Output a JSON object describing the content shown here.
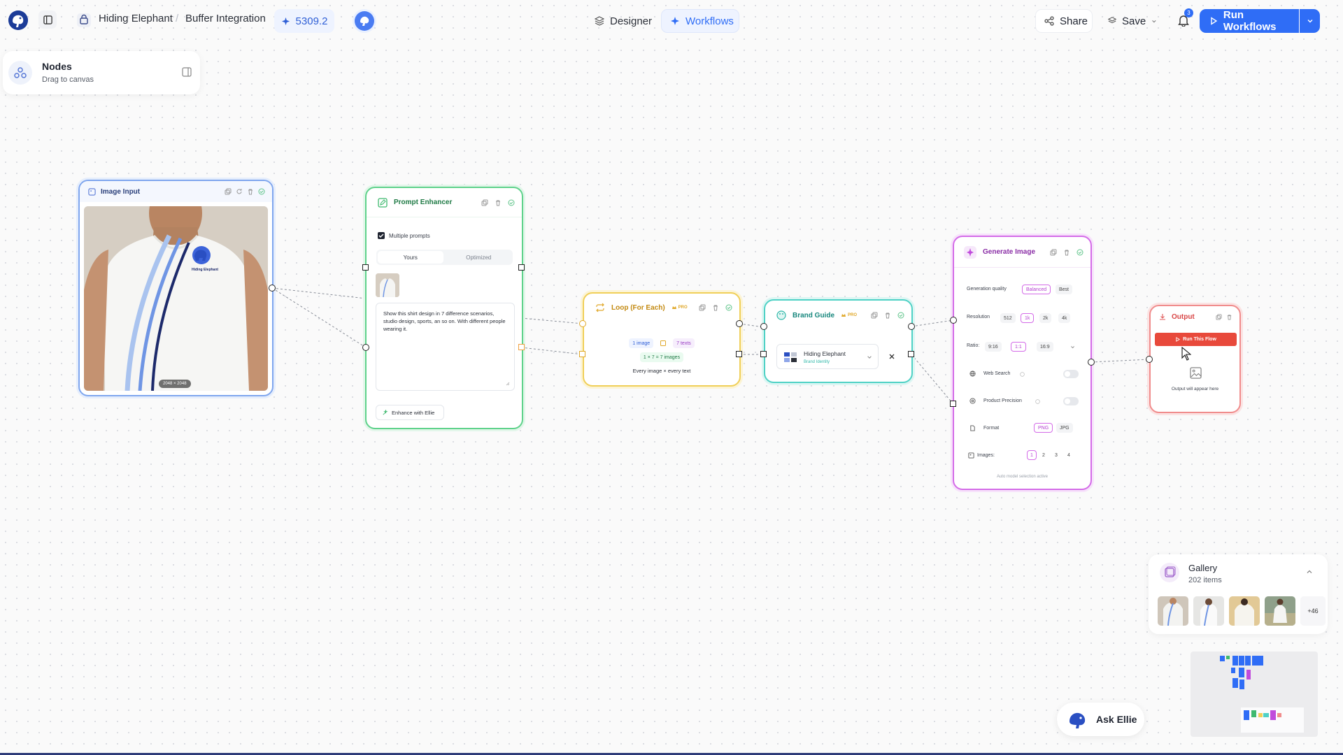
{
  "topbar": {
    "project": "Hiding Elephant",
    "page": "Buffer Integration",
    "credits": "5309.2",
    "tab_designer": "Designer",
    "tab_workflows": "Workflows",
    "share": "Share",
    "save": "Save",
    "notification_count": "3",
    "run": "Run Workflows"
  },
  "nodes_panel": {
    "title": "Nodes",
    "subtitle": "Drag to canvas"
  },
  "image_input": {
    "title": "Image Input",
    "size": "2048 × 2048",
    "shirt_brand": "Hiding Elephant"
  },
  "prompt_enhancer": {
    "title": "Prompt Enhancer",
    "multiple": "Multiple prompts",
    "tab_yours": "Yours",
    "tab_optimized": "Optimized",
    "prompt": "Show this shirt design in 7 difference scenarios, studio design, sports, an so on. With different people wearing it.",
    "enhance": "Enhance with Ellie"
  },
  "loop": {
    "title": "Loop (For Each)",
    "badge": "PRO",
    "images": "1 image",
    "texts": "7 texts",
    "result": "1 × 7 = 7 images",
    "desc": "Every image × every text"
  },
  "brand_guide": {
    "title": "Brand Guide",
    "badge": "PRO",
    "brand": "Hiding Elephant",
    "brand_sub": "Brand Identity"
  },
  "generate": {
    "title": "Generate Image",
    "quality_label": "Generation quality",
    "quality_opts": [
      "Balanced",
      "Best"
    ],
    "resolution_label": "Resolution",
    "res_opts": [
      "512",
      "1k",
      "2k",
      "4k"
    ],
    "ratio_label": "Ratio:",
    "ratio_opts": [
      "9:16",
      "1:1",
      "16:9"
    ],
    "web_search": "Web Search",
    "precision": "Product Precision",
    "format_label": "Format",
    "format_opts": [
      "PNG",
      "JPG"
    ],
    "images_label": "Images:",
    "images_opts": [
      "1",
      "2",
      "3",
      "4"
    ],
    "footer": "Auto model selection active"
  },
  "output": {
    "title": "Output",
    "run": "Run This Flow",
    "placeholder": "Output will appear here"
  },
  "gallery": {
    "title": "Gallery",
    "count": "202 items",
    "more": "+46"
  },
  "ask": "Ask Ellie",
  "colors": {
    "accent": "#2f6df6",
    "image_input": "#7fa6ee",
    "prompt_enhancer": "#5fd28b",
    "loop": "#f0cf58",
    "brand_guide": "#4fd1c5",
    "generate": "#d46be8",
    "output": "#f08c8c"
  }
}
